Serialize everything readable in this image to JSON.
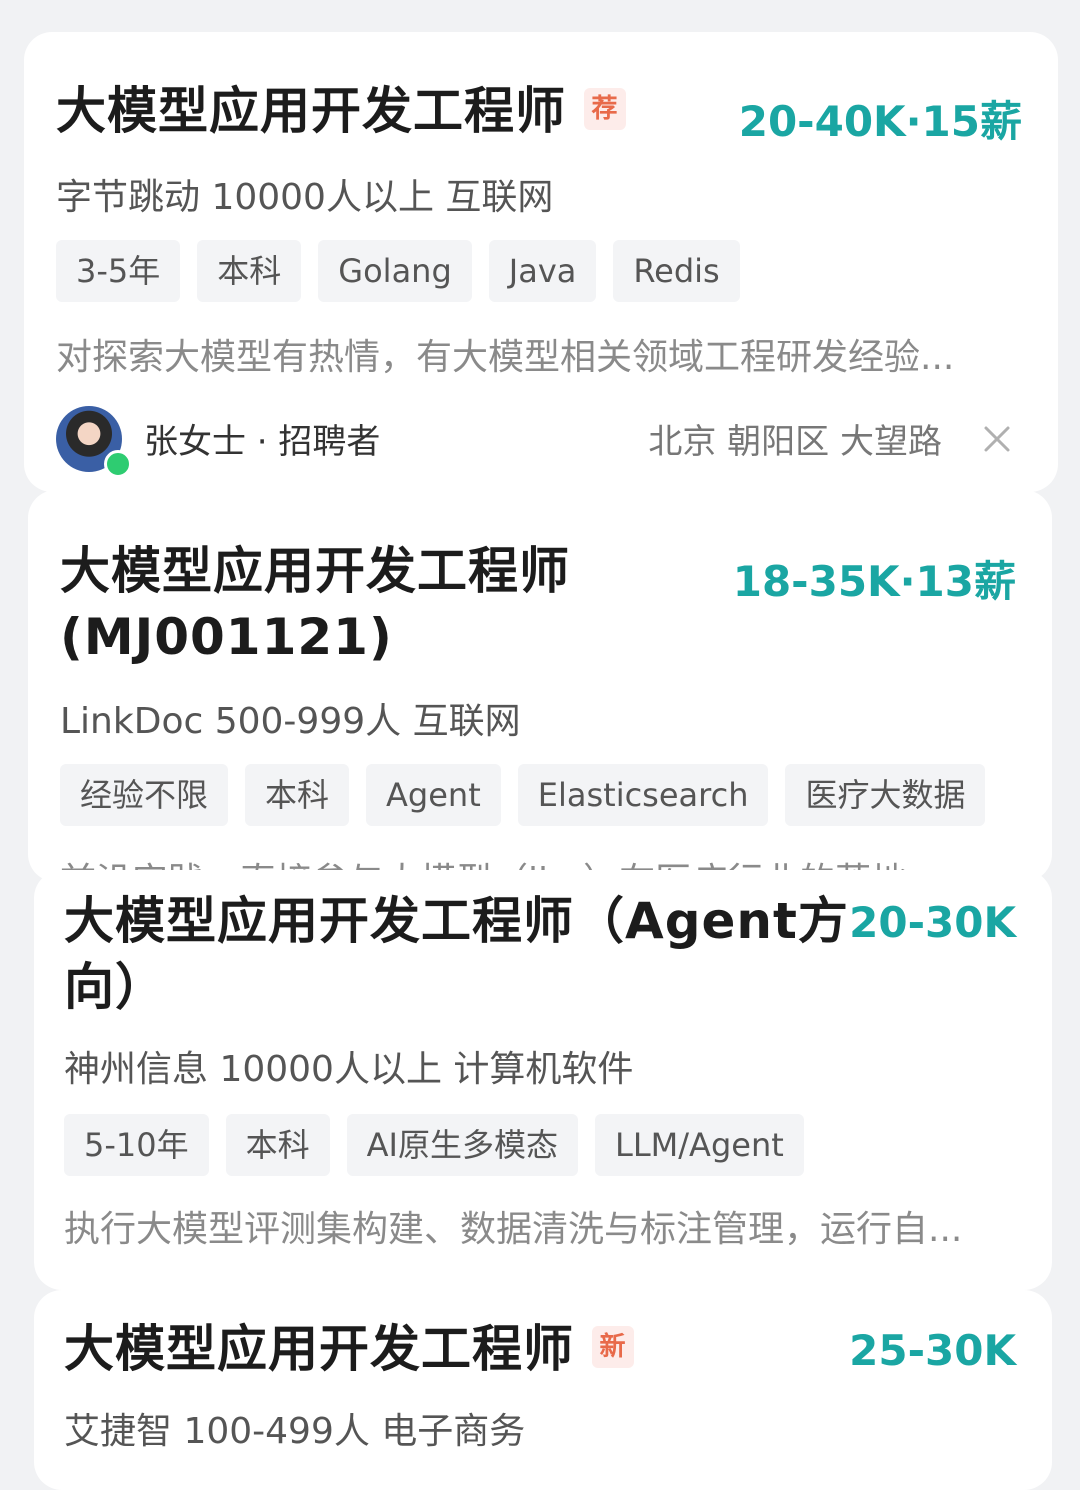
{
  "colors": {
    "salary": "#1aa6a3",
    "badge_text": "#e86a4a",
    "badge_bg": "#fdecea",
    "online_dot": "#2ecc71"
  },
  "jobs": [
    {
      "title": "大模型应用开发工程师",
      "badge": "荐",
      "salary": "20-40K·15薪",
      "company": "字节跳动 10000人以上 互联网",
      "tags": [
        "3-5年",
        "本科",
        "Golang",
        "Java",
        "Redis"
      ],
      "description": "对探索大模型有热情，有大模型相关领域工程研发经验...",
      "recruiter": "张女士 · 招聘者",
      "location": "北京 朝阳区 大望路"
    },
    {
      "title_line1": "大模型应用开发工程师",
      "title_line2": "(MJ001121)",
      "salary": "18-35K·13薪",
      "company": "LinkDoc 500-999人 互联网",
      "tags": [
        "经验不限",
        "本科",
        "Agent",
        "Elasticsearch",
        "医疗大数据"
      ],
      "description": "前沿实践：直接参与大模型（llm）在医疗行业的落地"
    },
    {
      "title_line1": "大模型应用开发工程师（Agent方",
      "title_line2": "向）",
      "salary": "20-30K",
      "company": "神州信息 10000人以上 计算机软件",
      "tags": [
        "5-10年",
        "本科",
        "AI原生多模态",
        "LLM/Agent"
      ],
      "description": "执行大模型评测集构建、数据清洗与标注管理，运行自..."
    },
    {
      "title": "大模型应用开发工程师",
      "badge": "新",
      "salary": "25-30K",
      "company": "艾捷智 100-499人 电子商务"
    }
  ]
}
